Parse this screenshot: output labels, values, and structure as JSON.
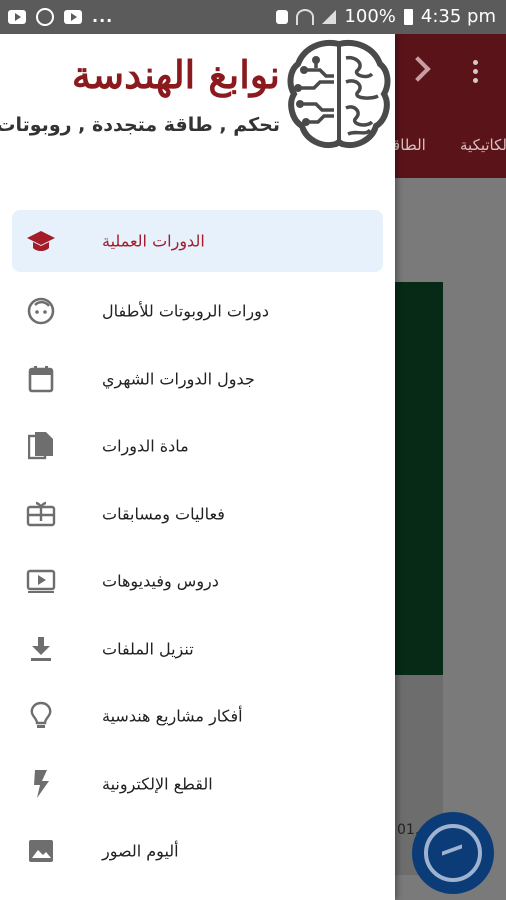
{
  "status_bar": {
    "icons": [
      "youtube-icon",
      "brightness-icon",
      "youtube-icon"
    ],
    "overflow": "...",
    "battery": "100%",
    "time": "4:35 pm"
  },
  "background_app": {
    "tabs": [
      "الطاقة",
      "الكاتيكية"
    ],
    "strip_text": "01."
  },
  "drawer": {
    "brand_title": "نوابغ الهندسة",
    "brand_subtitle": "تحكم , طاقة متجددة , روبوتات",
    "accent_color": "#8b1a1f",
    "active_color": "#a41c2a",
    "items": [
      {
        "label": "الدورات العملية",
        "icon": "graduation-cap-icon",
        "active": true
      },
      {
        "label": "دورات الروبوتات للأطفال",
        "icon": "child-face-icon",
        "active": false
      },
      {
        "label": "جدول الدورات الشهري",
        "icon": "calendar-icon",
        "active": false
      },
      {
        "label": "مادة الدورات",
        "icon": "file-copy-icon",
        "active": false
      },
      {
        "label": "فعاليات ومسابقات",
        "icon": "gift-card-icon",
        "active": false
      },
      {
        "label": "دروس وفيديوهات",
        "icon": "video-play-icon",
        "active": false
      },
      {
        "label": "تنزيل الملفات",
        "icon": "download-icon",
        "active": false
      },
      {
        "label": "أفكار مشاريع هندسية",
        "icon": "lightbulb-icon",
        "active": false
      },
      {
        "label": "القطع الإلكترونية",
        "icon": "flash-icon",
        "active": false
      },
      {
        "label": "أليوم الصور",
        "icon": "image-icon",
        "active": false
      }
    ]
  }
}
